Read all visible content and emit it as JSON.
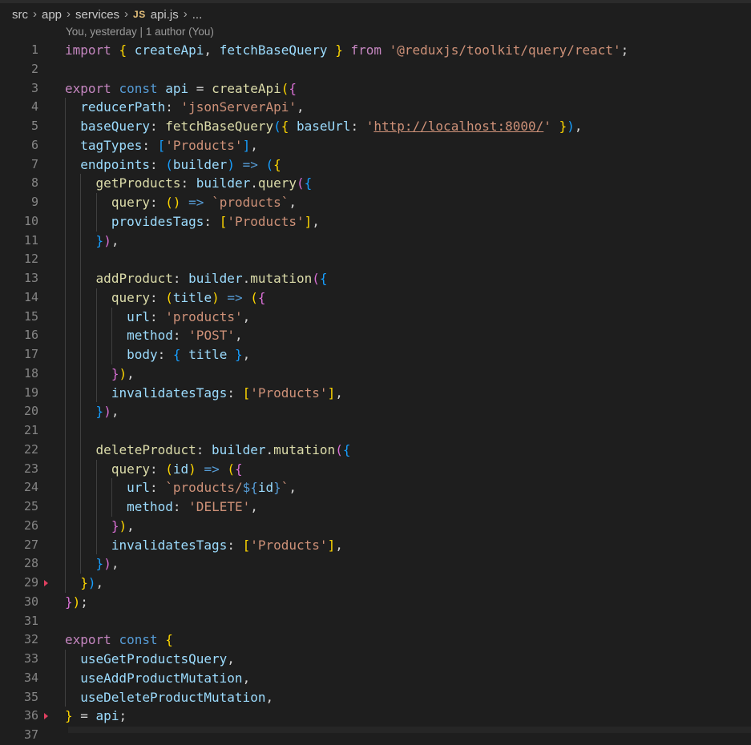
{
  "breadcrumb": {
    "segments": [
      "src",
      "app",
      "services"
    ],
    "file_badge": "JS",
    "file_name": "api.js",
    "trailing": "..."
  },
  "blame": {
    "text": "You, yesterday | 1 author (You)"
  },
  "gutter_markers": [
    29,
    36
  ],
  "lines": [
    {
      "n": "1",
      "indent": 0,
      "tokens": [
        [
          "kw",
          "import"
        ],
        [
          "pl",
          " "
        ],
        [
          "p1",
          "{"
        ],
        [
          "pl",
          " "
        ],
        [
          "var",
          "createApi"
        ],
        [
          "pl",
          ", "
        ],
        [
          "var",
          "fetchBaseQuery"
        ],
        [
          "pl",
          " "
        ],
        [
          "p1",
          "}"
        ],
        [
          "pl",
          " "
        ],
        [
          "kw",
          "from"
        ],
        [
          "pl",
          " "
        ],
        [
          "str",
          "'@reduxjs/toolkit/query/react'"
        ],
        [
          "pl",
          ";"
        ]
      ]
    },
    {
      "n": "2",
      "indent": 0,
      "tokens": []
    },
    {
      "n": "3",
      "indent": 0,
      "tokens": [
        [
          "kw",
          "export"
        ],
        [
          "pl",
          " "
        ],
        [
          "kb",
          "const"
        ],
        [
          "pl",
          " "
        ],
        [
          "var",
          "api"
        ],
        [
          "pl",
          " = "
        ],
        [
          "fn",
          "createApi"
        ],
        [
          "p1",
          "("
        ],
        [
          "p2",
          "{"
        ]
      ]
    },
    {
      "n": "4",
      "indent": 1,
      "tokens": [
        [
          "prop",
          "reducerPath"
        ],
        [
          "pl",
          ": "
        ],
        [
          "str",
          "'jsonServerApi'"
        ],
        [
          "pl",
          ","
        ]
      ]
    },
    {
      "n": "5",
      "indent": 1,
      "tokens": [
        [
          "prop",
          "baseQuery"
        ],
        [
          "pl",
          ": "
        ],
        [
          "fn",
          "fetchBaseQuery"
        ],
        [
          "p3",
          "("
        ],
        [
          "p1",
          "{"
        ],
        [
          "pl",
          " "
        ],
        [
          "prop",
          "baseUrl"
        ],
        [
          "pl",
          ": "
        ],
        [
          "str",
          "'"
        ],
        [
          "strl",
          "http://localhost:8000/"
        ],
        [
          "str",
          "'"
        ],
        [
          "pl",
          " "
        ],
        [
          "p1",
          "}"
        ],
        [
          "p3",
          ")"
        ],
        [
          "pl",
          ","
        ]
      ]
    },
    {
      "n": "6",
      "indent": 1,
      "tokens": [
        [
          "prop",
          "tagTypes"
        ],
        [
          "pl",
          ": "
        ],
        [
          "p3",
          "["
        ],
        [
          "str",
          "'Products'"
        ],
        [
          "p3",
          "]"
        ],
        [
          "pl",
          ","
        ]
      ]
    },
    {
      "n": "7",
      "indent": 1,
      "tokens": [
        [
          "prop",
          "endpoints"
        ],
        [
          "pl",
          ": "
        ],
        [
          "p3",
          "("
        ],
        [
          "var",
          "builder"
        ],
        [
          "p3",
          ")"
        ],
        [
          "pl",
          " "
        ],
        [
          "kb",
          "=>"
        ],
        [
          "pl",
          " "
        ],
        [
          "p3",
          "("
        ],
        [
          "p1",
          "{"
        ]
      ]
    },
    {
      "n": "8",
      "indent": 2,
      "tokens": [
        [
          "fn",
          "getProducts"
        ],
        [
          "pl",
          ": "
        ],
        [
          "var",
          "builder"
        ],
        [
          "pl",
          "."
        ],
        [
          "fn",
          "query"
        ],
        [
          "p2",
          "("
        ],
        [
          "p3",
          "{"
        ]
      ]
    },
    {
      "n": "9",
      "indent": 3,
      "tokens": [
        [
          "fn",
          "query"
        ],
        [
          "pl",
          ": "
        ],
        [
          "p1",
          "()"
        ],
        [
          "pl",
          " "
        ],
        [
          "kb",
          "=>"
        ],
        [
          "pl",
          " "
        ],
        [
          "str",
          "`products`"
        ],
        [
          "pl",
          ","
        ]
      ]
    },
    {
      "n": "10",
      "indent": 3,
      "tokens": [
        [
          "prop",
          "providesTags"
        ],
        [
          "pl",
          ": "
        ],
        [
          "p1",
          "["
        ],
        [
          "str",
          "'Products'"
        ],
        [
          "p1",
          "]"
        ],
        [
          "pl",
          ","
        ]
      ]
    },
    {
      "n": "11",
      "indent": 2,
      "tokens": [
        [
          "p3",
          "}"
        ],
        [
          "p2",
          ")"
        ],
        [
          "pl",
          ","
        ]
      ]
    },
    {
      "n": "12",
      "indent": 2,
      "tokens": []
    },
    {
      "n": "13",
      "indent": 2,
      "tokens": [
        [
          "fn",
          "addProduct"
        ],
        [
          "pl",
          ": "
        ],
        [
          "var",
          "builder"
        ],
        [
          "pl",
          "."
        ],
        [
          "fn",
          "mutation"
        ],
        [
          "p2",
          "("
        ],
        [
          "p3",
          "{"
        ]
      ]
    },
    {
      "n": "14",
      "indent": 3,
      "tokens": [
        [
          "fn",
          "query"
        ],
        [
          "pl",
          ": "
        ],
        [
          "p1",
          "("
        ],
        [
          "var",
          "title"
        ],
        [
          "p1",
          ")"
        ],
        [
          "pl",
          " "
        ],
        [
          "kb",
          "=>"
        ],
        [
          "pl",
          " "
        ],
        [
          "p1",
          "("
        ],
        [
          "p2",
          "{"
        ]
      ]
    },
    {
      "n": "15",
      "indent": 4,
      "tokens": [
        [
          "prop",
          "url"
        ],
        [
          "pl",
          ": "
        ],
        [
          "str",
          "'products'"
        ],
        [
          "pl",
          ","
        ]
      ]
    },
    {
      "n": "16",
      "indent": 4,
      "tokens": [
        [
          "prop",
          "method"
        ],
        [
          "pl",
          ": "
        ],
        [
          "str",
          "'POST'"
        ],
        [
          "pl",
          ","
        ]
      ]
    },
    {
      "n": "17",
      "indent": 4,
      "tokens": [
        [
          "prop",
          "body"
        ],
        [
          "pl",
          ": "
        ],
        [
          "p3",
          "{"
        ],
        [
          "pl",
          " "
        ],
        [
          "var",
          "title"
        ],
        [
          "pl",
          " "
        ],
        [
          "p3",
          "}"
        ],
        [
          "pl",
          ","
        ]
      ]
    },
    {
      "n": "18",
      "indent": 3,
      "tokens": [
        [
          "p2",
          "}"
        ],
        [
          "p1",
          ")"
        ],
        [
          "pl",
          ","
        ]
      ]
    },
    {
      "n": "19",
      "indent": 3,
      "tokens": [
        [
          "prop",
          "invalidatesTags"
        ],
        [
          "pl",
          ": "
        ],
        [
          "p1",
          "["
        ],
        [
          "str",
          "'Products'"
        ],
        [
          "p1",
          "]"
        ],
        [
          "pl",
          ","
        ]
      ]
    },
    {
      "n": "20",
      "indent": 2,
      "tokens": [
        [
          "p3",
          "}"
        ],
        [
          "p2",
          ")"
        ],
        [
          "pl",
          ","
        ]
      ]
    },
    {
      "n": "21",
      "indent": 2,
      "tokens": []
    },
    {
      "n": "22",
      "indent": 2,
      "tokens": [
        [
          "fn",
          "deleteProduct"
        ],
        [
          "pl",
          ": "
        ],
        [
          "var",
          "builder"
        ],
        [
          "pl",
          "."
        ],
        [
          "fn",
          "mutation"
        ],
        [
          "p2",
          "("
        ],
        [
          "p3",
          "{"
        ]
      ]
    },
    {
      "n": "23",
      "indent": 3,
      "tokens": [
        [
          "fn",
          "query"
        ],
        [
          "pl",
          ": "
        ],
        [
          "p1",
          "("
        ],
        [
          "var",
          "id"
        ],
        [
          "p1",
          ")"
        ],
        [
          "pl",
          " "
        ],
        [
          "kb",
          "=>"
        ],
        [
          "pl",
          " "
        ],
        [
          "p1",
          "("
        ],
        [
          "p2",
          "{"
        ]
      ]
    },
    {
      "n": "24",
      "indent": 4,
      "tokens": [
        [
          "prop",
          "url"
        ],
        [
          "pl",
          ": "
        ],
        [
          "str",
          "`products/"
        ],
        [
          "kb",
          "${"
        ],
        [
          "var",
          "id"
        ],
        [
          "kb",
          "}"
        ],
        [
          "str",
          "`"
        ],
        [
          "pl",
          ","
        ]
      ]
    },
    {
      "n": "25",
      "indent": 4,
      "tokens": [
        [
          "prop",
          "method"
        ],
        [
          "pl",
          ": "
        ],
        [
          "str",
          "'DELETE'"
        ],
        [
          "pl",
          ","
        ]
      ]
    },
    {
      "n": "26",
      "indent": 3,
      "tokens": [
        [
          "p2",
          "}"
        ],
        [
          "p1",
          ")"
        ],
        [
          "pl",
          ","
        ]
      ]
    },
    {
      "n": "27",
      "indent": 3,
      "tokens": [
        [
          "prop",
          "invalidatesTags"
        ],
        [
          "pl",
          ": "
        ],
        [
          "p1",
          "["
        ],
        [
          "str",
          "'Products'"
        ],
        [
          "p1",
          "]"
        ],
        [
          "pl",
          ","
        ]
      ]
    },
    {
      "n": "28",
      "indent": 2,
      "tokens": [
        [
          "p3",
          "}"
        ],
        [
          "p2",
          ")"
        ],
        [
          "pl",
          ","
        ]
      ]
    },
    {
      "n": "29",
      "indent": 1,
      "tokens": [
        [
          "p1",
          "}"
        ],
        [
          "p3",
          ")"
        ],
        [
          "pl",
          ","
        ]
      ]
    },
    {
      "n": "30",
      "indent": 0,
      "tokens": [
        [
          "p2",
          "}"
        ],
        [
          "p1",
          ")"
        ],
        [
          "pl",
          ";"
        ]
      ]
    },
    {
      "n": "31",
      "indent": 0,
      "tokens": []
    },
    {
      "n": "32",
      "indent": 0,
      "tokens": [
        [
          "kw",
          "export"
        ],
        [
          "pl",
          " "
        ],
        [
          "kb",
          "const"
        ],
        [
          "pl",
          " "
        ],
        [
          "p1",
          "{"
        ]
      ]
    },
    {
      "n": "33",
      "indent": 1,
      "tokens": [
        [
          "var",
          "useGetProductsQuery"
        ],
        [
          "pl",
          ","
        ]
      ]
    },
    {
      "n": "34",
      "indent": 1,
      "tokens": [
        [
          "var",
          "useAddProductMutation"
        ],
        [
          "pl",
          ","
        ]
      ]
    },
    {
      "n": "35",
      "indent": 1,
      "tokens": [
        [
          "var",
          "useDeleteProductMutation"
        ],
        [
          "pl",
          ","
        ]
      ]
    },
    {
      "n": "36",
      "indent": 0,
      "tokens": [
        [
          "p1",
          "}"
        ],
        [
          "pl",
          " = "
        ],
        [
          "var",
          "api"
        ],
        [
          "pl",
          ";"
        ]
      ]
    },
    {
      "n": "37",
      "indent": 0,
      "tokens": []
    }
  ]
}
